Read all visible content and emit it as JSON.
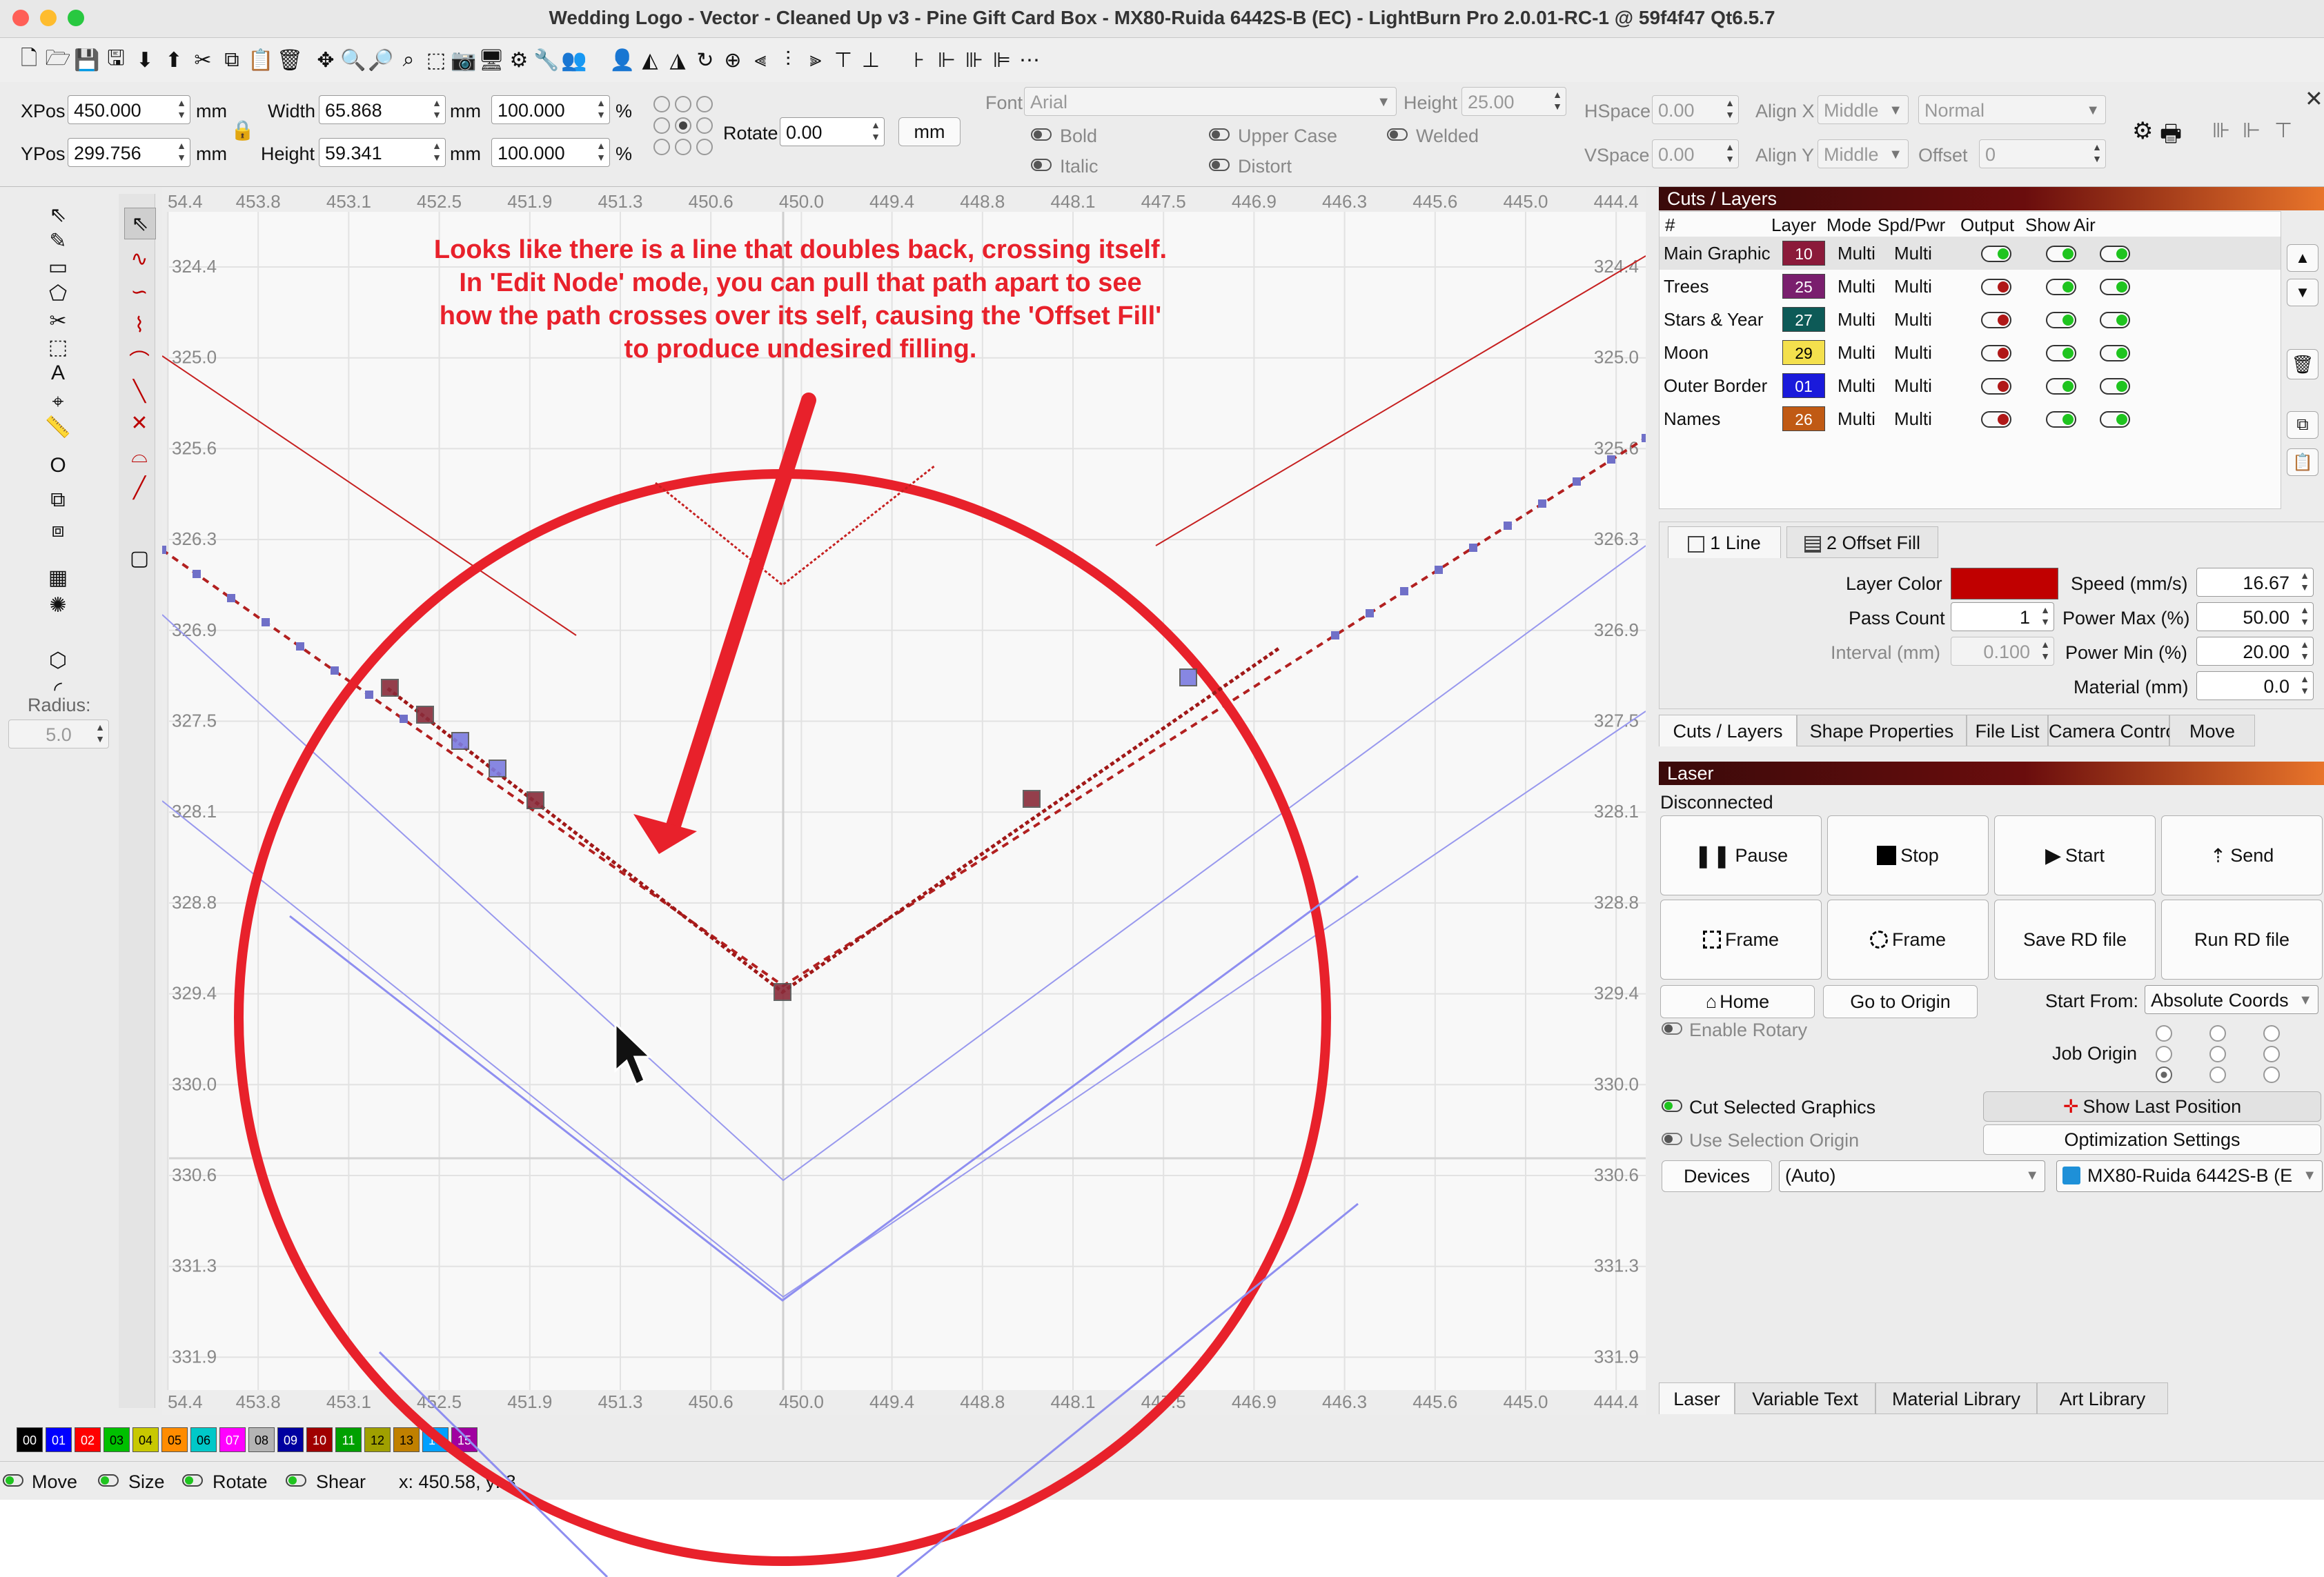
{
  "window": {
    "title": "Wedding Logo - Vector - Cleaned Up v3 - Pine Gift Card Box - MX80-Ruida 6442S-B (EC) - LightBurn Pro 2.0.01-RC-1 @ 59f4f47 Qt6.5.7"
  },
  "toolbar": {
    "icons": [
      "new-icon",
      "open-icon",
      "save-icon",
      "save-as-icon",
      "import-icon",
      "export-icon",
      "cut-icon",
      "copy-icon",
      "paste-icon",
      "delete-icon",
      "move-icon",
      "zoom-in-icon",
      "zoom-out-icon",
      "zoom-fit-icon",
      "zoom-select-icon",
      "camera-icon",
      "monitor-icon",
      "settings-icon",
      "tools-icon",
      "group-icon",
      "user-icon",
      "mirror-h-icon",
      "mirror-v-icon",
      "rotate-icon",
      "center-icon",
      "align-left-icon",
      "align-center-icon",
      "align-right-icon",
      "align-top-icon",
      "align-middle-icon",
      "align-bottom-icon",
      "distribute-icon",
      "dock-icon",
      "push-icon",
      "grid-icon"
    ]
  },
  "props": {
    "xpos_label": "XPos",
    "xpos": "450.000",
    "ypos_label": "YPos",
    "ypos": "299.756",
    "unit": "mm",
    "width_label": "Width",
    "width": "65.868",
    "height_label": "Height",
    "height": "59.341",
    "scale_w": "100.000",
    "scale_h": "100.000",
    "pct": "%",
    "rotate_label": "Rotate",
    "rotate": "0.00",
    "unit_button": "mm",
    "font_label": "Font",
    "font": "Arial",
    "font_height_label": "Height",
    "font_height": "25.00",
    "bold": "Bold",
    "italic": "Italic",
    "upper_case": "Upper Case",
    "distort": "Distort",
    "welded": "Welded",
    "hspace_label": "HSpace",
    "hspace": "0.00",
    "vspace_label": "VSpace",
    "vspace": "0.00",
    "alignx_label": "Align X",
    "alignx": "Middle",
    "aligny_label": "Align Y",
    "aligny": "Middle",
    "normal": "Normal",
    "offset_label": "Offset",
    "offset": "0"
  },
  "left_tools": {
    "radius_label": "Radius:",
    "radius": "5.0"
  },
  "canvas": {
    "x_ruler": [
      "54.4",
      "453.8",
      "453.1",
      "452.5",
      "451.9",
      "451.3",
      "450.6",
      "450.0",
      "449.4",
      "448.8",
      "448.1",
      "447.5",
      "446.9",
      "446.3",
      "445.6",
      "445.0",
      "444.4"
    ],
    "y_ruler": [
      "324.4",
      "325.0",
      "325.6",
      "326.3",
      "326.9",
      "327.5",
      "328.1",
      "328.8",
      "329.4",
      "330.0",
      "330.6",
      "331.3",
      "331.9"
    ],
    "annotation": [
      "Looks like there is a line that doubles back, crossing itself.",
      "In 'Edit Node' mode, you can pull that path apart to see",
      "how the path crosses over its self, causing the 'Offset Fill'",
      "to produce undesired filling."
    ],
    "annotation_color": "#e8212b"
  },
  "cuts_layers": {
    "header": "Cuts / Layers",
    "columns": [
      "#",
      "Layer",
      "Mode",
      "Spd/Pwr",
      "Output",
      "Show",
      "Air"
    ],
    "rows": [
      {
        "name": "Main Graphic",
        "layer": "10",
        "color": "#8b1a3a",
        "mode": "Multi",
        "spd": "Multi",
        "output": true
      },
      {
        "name": "Trees",
        "layer": "25",
        "color": "#7a1f6e",
        "mode": "Multi",
        "spd": "Multi",
        "output": false
      },
      {
        "name": "Stars & Year",
        "layer": "27",
        "color": "#0d5a57",
        "mode": "Multi",
        "spd": "Multi",
        "output": false
      },
      {
        "name": "Moon",
        "layer": "29",
        "color": "#f4e04d",
        "mode": "Multi",
        "spd": "Multi",
        "output": false
      },
      {
        "name": "Outer Border",
        "layer": "01",
        "color": "#1a1adb",
        "mode": "Multi",
        "spd": "Multi",
        "output": false
      },
      {
        "name": "Names",
        "layer": "26",
        "color": "#c05a14",
        "mode": "Multi",
        "spd": "Multi",
        "output": false
      }
    ],
    "subtabs": [
      "1 Line",
      "2 Offset Fill"
    ],
    "layer_color_label": "Layer Color",
    "layer_color": "#c00000",
    "pass_count_label": "Pass Count",
    "pass_count": "1",
    "interval_label": "Interval (mm)",
    "interval": "0.100",
    "speed_label": "Speed (mm/s)",
    "speed": "16.67",
    "power_max_label": "Power Max (%)",
    "power_max": "50.00",
    "power_min_label": "Power Min (%)",
    "power_min": "20.00",
    "material_label": "Material (mm)",
    "material": "0.0"
  },
  "panel_tabs": [
    "Cuts / Layers",
    "Shape Properties",
    "File List",
    "Camera Control",
    "Move"
  ],
  "laser": {
    "header": "Laser",
    "status": "Disconnected",
    "pause": "Pause",
    "stop": "Stop",
    "start": "Start",
    "send": "Send",
    "frame1": "Frame",
    "frame2": "Frame",
    "save_rd": "Save RD file",
    "run_rd": "Run RD file",
    "home": "Home",
    "go_origin": "Go to Origin",
    "start_from_label": "Start From:",
    "start_from": "Absolute Coords",
    "enable_rotary": "Enable Rotary",
    "job_origin": "Job Origin",
    "cut_selected": "Cut Selected Graphics",
    "use_selection_origin": "Use Selection Origin",
    "show_last_position": "Show Last Position",
    "optimization_settings": "Optimization Settings",
    "devices": "Devices",
    "auto": "(Auto)",
    "device": "MX80-Ruida 6442S-B (E"
  },
  "bottom_tabs": [
    "Laser",
    "Variable Text",
    "Material Library",
    "Art Library"
  ],
  "palette": [
    {
      "n": "00",
      "c": "#000000",
      "t": "#fff"
    },
    {
      "n": "01",
      "c": "#0000ff",
      "t": "#fff"
    },
    {
      "n": "02",
      "c": "#ff0000",
      "t": "#fff"
    },
    {
      "n": "03",
      "c": "#00c000",
      "t": "#000"
    },
    {
      "n": "04",
      "c": "#c8c800",
      "t": "#000"
    },
    {
      "n": "05",
      "c": "#ff8c00",
      "t": "#000"
    },
    {
      "n": "06",
      "c": "#00c8c8",
      "t": "#000"
    },
    {
      "n": "07",
      "c": "#ff00ff",
      "t": "#fff"
    },
    {
      "n": "08",
      "c": "#b4b4b4",
      "t": "#000"
    },
    {
      "n": "09",
      "c": "#0000a0",
      "t": "#fff"
    },
    {
      "n": "10",
      "c": "#a00000",
      "t": "#fff"
    },
    {
      "n": "11",
      "c": "#00a000",
      "t": "#fff"
    },
    {
      "n": "12",
      "c": "#a0a000",
      "t": "#000"
    },
    {
      "n": "13",
      "c": "#c08000",
      "t": "#000"
    },
    {
      "n": "14",
      "c": "#00a0ff",
      "t": "#fff"
    },
    {
      "n": "15",
      "c": "#a000a0",
      "t": "#fff"
    }
  ],
  "status": {
    "move": "Move",
    "size": "Size",
    "rotate": "Rotate",
    "shear": "Shear",
    "coords": "x: 450.58, y: 3"
  }
}
